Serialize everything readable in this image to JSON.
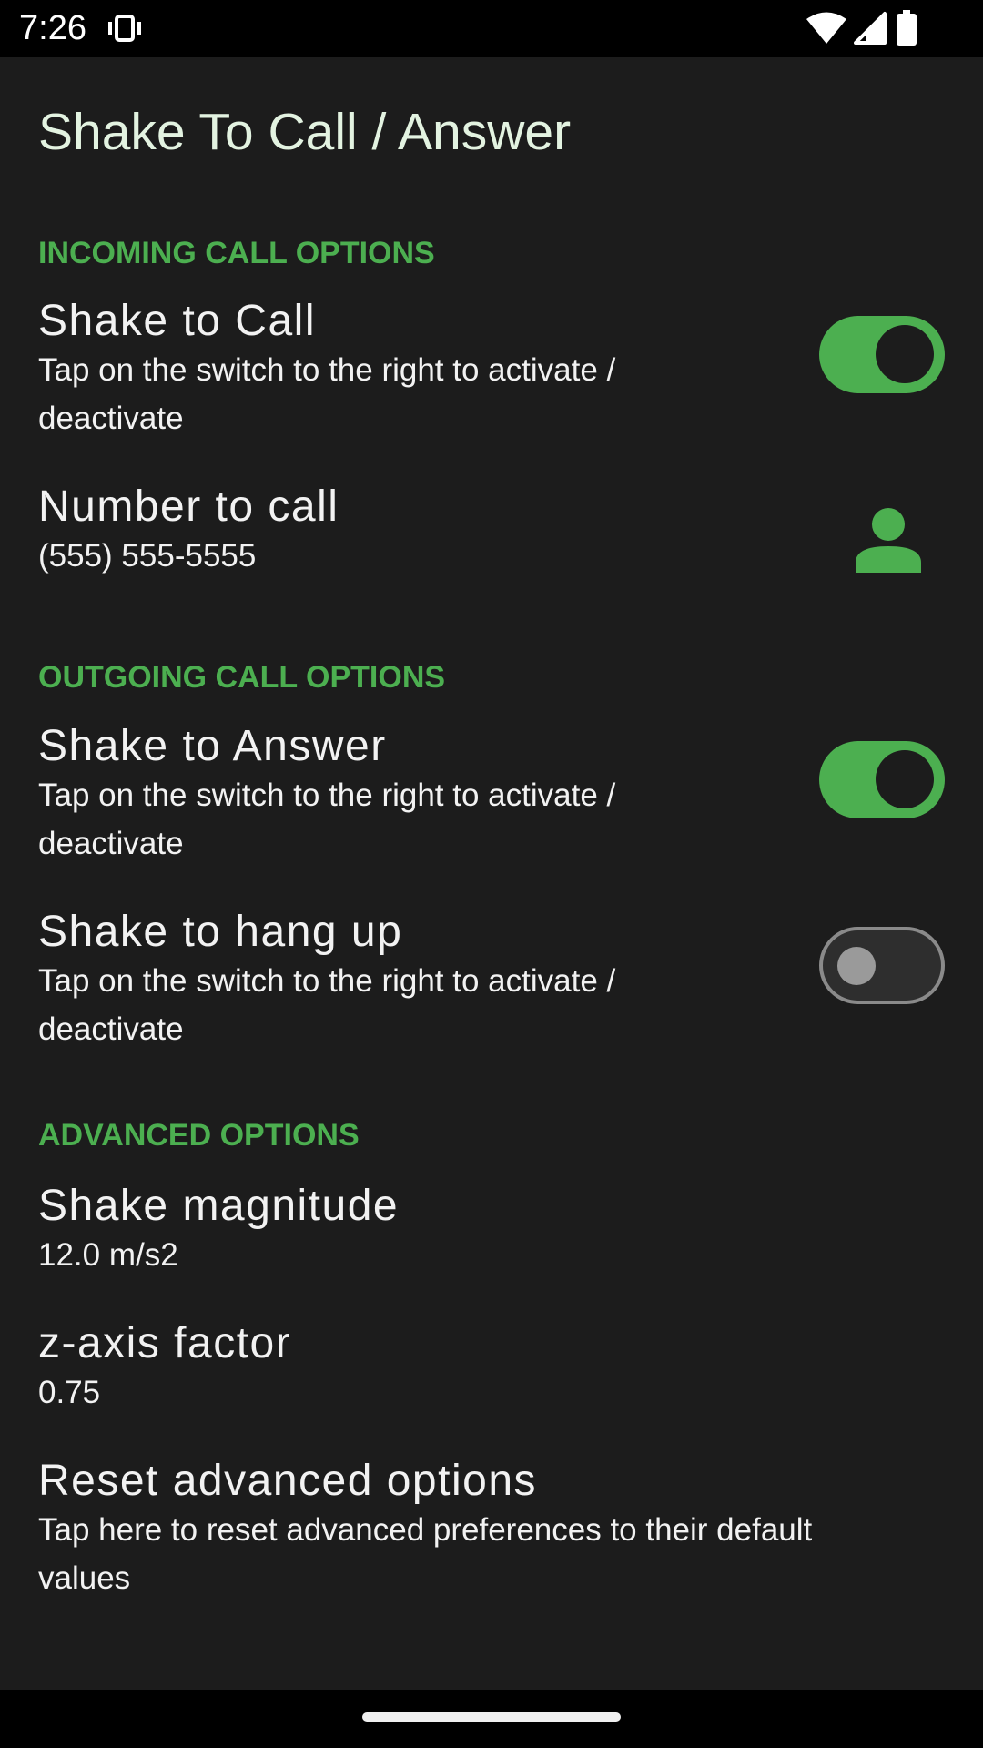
{
  "status_bar": {
    "time": "7:26",
    "icons": [
      "vibrate-icon",
      "wifi-icon",
      "cell-signal-icon",
      "battery-icon"
    ]
  },
  "page": {
    "title": "Shake To Call / Answer"
  },
  "sections": {
    "incoming": {
      "header": "INCOMING CALL OPTIONS",
      "shake_to_call": {
        "title": "Shake to Call",
        "summary": "Tap on the switch to the right to activate / deactivate",
        "enabled": true
      },
      "number_to_call": {
        "title": "Number to call",
        "value": "(555) 555-5555",
        "icon": "contact-person-icon"
      }
    },
    "outgoing": {
      "header": "OUTGOING CALL OPTIONS",
      "shake_to_answer": {
        "title": "Shake to Answer",
        "summary": "Tap on the switch to the right to activate / deactivate",
        "enabled": true
      },
      "shake_to_hang_up": {
        "title": "Shake to hang up",
        "summary": "Tap on the switch to the right to activate / deactivate",
        "enabled": false
      }
    },
    "advanced": {
      "header": "ADVANCED OPTIONS",
      "shake_magnitude": {
        "title": "Shake magnitude",
        "value": "12.0 m/s2"
      },
      "z_axis_factor": {
        "title": "z-axis factor",
        "value": "0.75"
      },
      "reset": {
        "title": "Reset advanced options",
        "summary": "Tap here to reset advanced preferences to their default values"
      }
    }
  },
  "colors": {
    "accent": "#4caf50",
    "background": "#1c1c1c",
    "text": "#f2f2f2"
  }
}
